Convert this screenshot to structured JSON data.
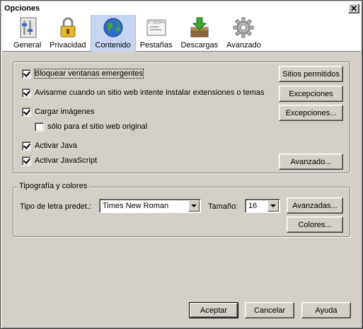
{
  "window": {
    "title": "Opciones",
    "close_glyph": "✕"
  },
  "tabs": [
    {
      "label": "General",
      "icon": "general-icon"
    },
    {
      "label": "Privacidad",
      "icon": "lock-icon"
    },
    {
      "label": "Contenido",
      "icon": "globe-icon",
      "selected": true
    },
    {
      "label": "Pestañas",
      "icon": "tabs-window-icon"
    },
    {
      "label": "Descargas",
      "icon": "download-box-icon"
    },
    {
      "label": "Avanzado",
      "icon": "gear-icon"
    }
  ],
  "content": {
    "block_popups": {
      "label": "Bloquear ventanas emergentes",
      "checked": true
    },
    "warn_extensions": {
      "label": "Avisarme cuando un sitio web intente instalar extensiones o temas",
      "checked": true
    },
    "load_images": {
      "label": "Cargar imágenes",
      "checked": true
    },
    "only_original": {
      "label": "sólo para el sitio web original",
      "checked": false
    },
    "enable_java": {
      "label": "Activar Java",
      "checked": true
    },
    "enable_javascript": {
      "label": "Activar JavaScript",
      "checked": true
    },
    "buttons": {
      "allowed_sites": "Sitios permitidos",
      "exceptions_1": "Excepciones",
      "exceptions_2": "Excepciones...",
      "advanced": "Avanzado..."
    }
  },
  "fonts": {
    "group_label": "Tipografía y colores",
    "default_font_label": "Tipo de letra predet.:",
    "default_font_value": "Times New Roman",
    "size_label": "Tamaño:",
    "size_value": "16",
    "advanced_button": "Avanzadas...",
    "colors_button": "Colores..."
  },
  "footer": {
    "ok": "Aceptar",
    "cancel": "Cancelar",
    "help": "Ayuda"
  },
  "colors": {
    "selected_tab_bg": "#c6d6f0",
    "dialog_bg": "#d4d0c8"
  }
}
